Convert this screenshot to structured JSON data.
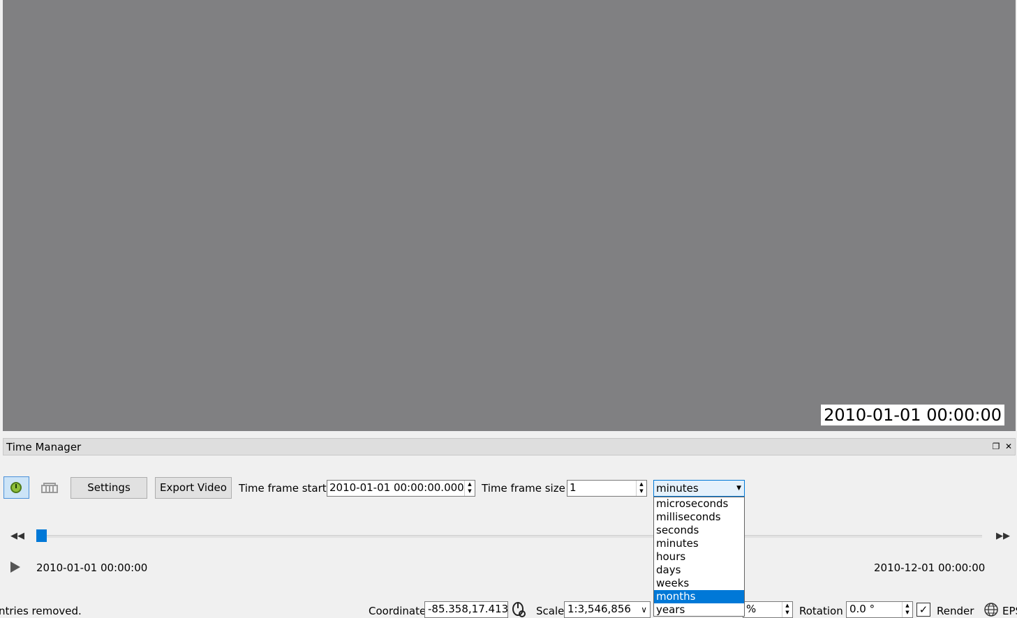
{
  "map": {
    "overlay_timestamp": "2010-01-01 00:00:00"
  },
  "panel": {
    "title": "Time Manager",
    "float_icon": "restore-icon",
    "close_icon": "close-icon"
  },
  "toolbar": {
    "power_icon": "power-icon",
    "archive_icon": "archive-icon",
    "settings_label": "Settings",
    "export_label": "Export Video",
    "time_frame_start_label": "Time frame start",
    "time_frame_start_value": "2010-01-01 00:00:00.000",
    "time_frame_size_label": "Time frame size",
    "time_frame_size_value": "1",
    "unit_selected": "minutes"
  },
  "unit_options": [
    "microseconds",
    "milliseconds",
    "seconds",
    "minutes",
    "hours",
    "days",
    "weeks",
    "months",
    "years"
  ],
  "unit_highlighted": "months",
  "timeline": {
    "rewind_icon": "rewind-icon",
    "forward_icon": "fast-forward-icon",
    "play_icon": "play-icon",
    "start_time": "2010-01-01 00:00:00",
    "end_time": "2010-12-01 00:00:00",
    "slider_position": 0
  },
  "statusbar": {
    "message": "ntries removed.",
    "coordinate_label": "Coordinate",
    "coordinate_value": "-85.358,17.413",
    "scale_label": "Scale",
    "scale_value": "1:3,546,856",
    "magnifier_value_suffix": "%",
    "rotation_label": "Rotation",
    "rotation_value": "0.0 °",
    "render_label": "Render",
    "render_checked": true,
    "crs_label": "EPS"
  },
  "colors": {
    "map_background": "#808082",
    "accent": "#0078d7",
    "panel_background": "#f0f0f0"
  }
}
